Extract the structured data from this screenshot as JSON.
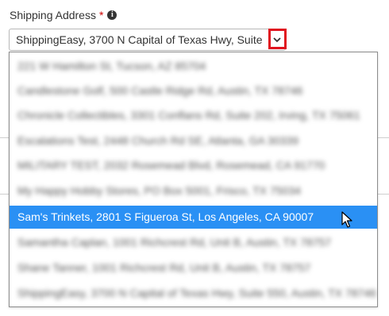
{
  "form": {
    "label": "Shipping Address",
    "required_mark": "*",
    "info_icon": "info-icon",
    "selected_value": "ShippingEasy, 3700 N Capital of Texas Hwy, Suite",
    "arrow_icon": "chevron-down-icon"
  },
  "dropdown": {
    "options": [
      {
        "label": "221 W Hamilton St, Tucson, AZ 85704",
        "state": "blurred"
      },
      {
        "label": "Candlestone Golf, 500 Castle Ridge Rd, Austin, TX 78746",
        "state": "blurred"
      },
      {
        "label": "Chronicle Collectibles, 3301 Conflans Rd, Suite 202, Irving, TX 75061",
        "state": "blurred"
      },
      {
        "label": "Escalations Test, 2448 Church Rd SE, Atlanta, GA 30339",
        "state": "blurred"
      },
      {
        "label": "MILITARY TEST, 2032 Rosemead Blvd, Rosemead, CA 91770",
        "state": "blurred"
      },
      {
        "label": "My Happy Hobby Stores, PO Box 5001, Frisco, TX 75034",
        "state": "blurred"
      },
      {
        "label": "Sam's Trinkets, 2801 S Figueroa St, Los Angeles, CA 90007",
        "state": "selected"
      },
      {
        "label": "Samantha Caplan, 1001 Richcrest Rd, Unit B, Austin, TX 78757",
        "state": "blurred"
      },
      {
        "label": "Shane Tanner, 1001 Richcrest Rd, Unit B, Austin, TX 78757",
        "state": "blurred"
      },
      {
        "label": "ShippingEasy, 3700 N Capital of Texas Hwy, Suite 550, Austin, TX 78746",
        "state": "blurred"
      }
    ]
  },
  "colors": {
    "selected_bg": "#2a90f4",
    "highlight_border": "#e0141f",
    "required": "#cc0000"
  }
}
